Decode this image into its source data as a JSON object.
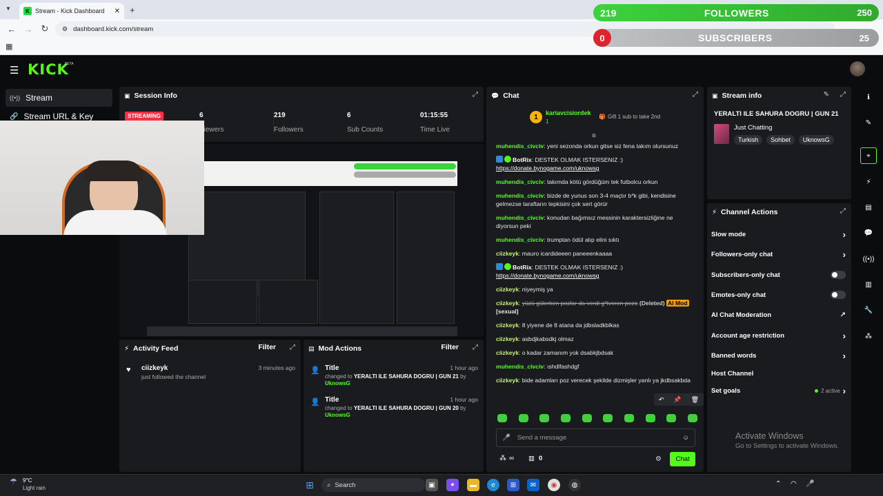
{
  "browser": {
    "tab_title": "Stream - Kick Dashboard",
    "url": "dashboard.kick.com/stream"
  },
  "overlay": {
    "followers_current": "219",
    "followers_label": "FOLLOWERS",
    "followers_goal": "250",
    "followers_progress": 0.876,
    "subscribers_current": "0",
    "subscribers_label": "SUBSCRIBERS",
    "subscribers_goal": "25",
    "subscribers_progress": 0.0
  },
  "header": {
    "logo": "KICK",
    "beta": "BETA"
  },
  "nav": {
    "items": [
      {
        "label": "Stream"
      },
      {
        "label": "Stream URL & Key"
      }
    ]
  },
  "session": {
    "title": "Session Info",
    "status": "STREAMING",
    "stats": [
      {
        "value": "6",
        "label": "Viewers"
      },
      {
        "value": "219",
        "label": "Followers"
      },
      {
        "value": "6",
        "label": "Sub Counts"
      },
      {
        "value": "01:15:55",
        "label": "Time Live"
      }
    ]
  },
  "activity": {
    "title": "Activity Feed",
    "filter": "Filter",
    "items": [
      {
        "user": "ciizkeyk",
        "text": "just followed the channel",
        "time": "3 minutes ago"
      }
    ]
  },
  "mod": {
    "title": "Mod Actions",
    "filter": "Filter",
    "items": [
      {
        "title": "Title",
        "time": "1 hour ago",
        "prefix": "changed to",
        "value": "YERALTI ILE SAHURA DOGRU | GUN 21",
        "by": "by",
        "user": "UknowsG"
      },
      {
        "title": "Title",
        "time": "1 hour ago",
        "prefix": "changed to",
        "value": "YERALTI ILE SAHURA DOGRU | GUN 20",
        "by": "by",
        "user": "UknowsG"
      }
    ]
  },
  "chat": {
    "title": "Chat",
    "top_gifter": {
      "rank": "1",
      "name": "kariavcisiordek",
      "count": "1"
    },
    "gift_text": "Gift 1 sub to take 2nd",
    "messages": [
      {
        "user": "muhendis_civciv",
        "text": "yeni sezonda orkun gitse siz fena takım olursunuz"
      },
      {
        "user": "BotRix",
        "text": "DESTEK OLMAK ISTERSENIZ :)",
        "link": "https://donate.bynogame.com/uknowsg"
      },
      {
        "user": "muhendis_civciv",
        "text": "takımda kötü gördüğüm tek futbolcu orkun"
      },
      {
        "user": "muhendis_civciv",
        "text": "bizde de yunus son 3-4 maçtır b*k gibi, kendisine gelmezse taraftarın tepkisini çok sert görür"
      },
      {
        "user": "muhendis_civciv",
        "text": "konudan bağımsız messinin karaktersizliğine ne diyorsun peki"
      },
      {
        "user": "muhendis_civciv",
        "text": "trumptan ödül alıp elini sıktı"
      },
      {
        "user": "ciizkeyk",
        "text": "mauro icardideeen paneeenkaaaa"
      },
      {
        "user": "BotRix",
        "text": "DESTEK OLMAK ISTERSENIZ :)",
        "link": "https://donate.bynogame.com/uknowsg"
      },
      {
        "user": "ciizkeyk",
        "text": "niyeymiş ya"
      },
      {
        "user": "ciizkeyk",
        "text": "yüzü gülerken pozlar da verdi g*tveren pezo",
        "deleted": "(Deleted)",
        "aimod": "AI Mod",
        "tag": "[sexual]"
      },
      {
        "user": "ciizkeyk",
        "text": "8 yiyene de 8 atana da jdbsladkblkas"
      },
      {
        "user": "ciizkeyk",
        "text": "asbdjkabsdkj olmaz"
      },
      {
        "user": "ciizkeyk",
        "text": "o kadar zamanım yok dsabkjbdsak"
      },
      {
        "user": "muhendis_civciv",
        "text": "ıshdlfashdgf"
      },
      {
        "user": "ciizkeyk",
        "text": "bide adamları poz verecek şekilde dizmişler yanlı ya jkdbsakbda"
      }
    ],
    "input_placeholder": "Send a message",
    "points": "0",
    "send_label": "Chat"
  },
  "stream_info": {
    "title": "Stream info",
    "stream_title": "YERALTI ILE SAHURA DOGRU | GUN 21",
    "category": "Just Chatting",
    "tags": [
      "Turkish",
      "Sohbet",
      "UknowsG"
    ]
  },
  "channel_actions": {
    "title": "Channel Actions",
    "items": [
      {
        "label": "Slow mode",
        "control": "chevron"
      },
      {
        "label": "Followers-only chat",
        "control": "chevron"
      },
      {
        "label": "Subscribers-only chat",
        "control": "toggle"
      },
      {
        "label": "Emotes-only chat",
        "control": "toggle"
      },
      {
        "label": "AI Chat Moderation",
        "control": "external"
      },
      {
        "label": "Account age restriction",
        "control": "chevron"
      },
      {
        "label": "Banned words",
        "control": "chevron"
      },
      {
        "label": "Host Channel",
        "control": "none"
      },
      {
        "label": "Set goals",
        "control": "chevron",
        "status": "2 active"
      }
    ]
  },
  "watermark": {
    "line1": "Activate Windows",
    "line2": "Go to Settings to activate Windows."
  },
  "taskbar": {
    "weather_temp": "9°C",
    "weather_desc": "Light rain",
    "search": "Search"
  },
  "colors": {
    "accent": "#53fc18",
    "live": "#ff2d43",
    "panel": "#191b1f"
  }
}
